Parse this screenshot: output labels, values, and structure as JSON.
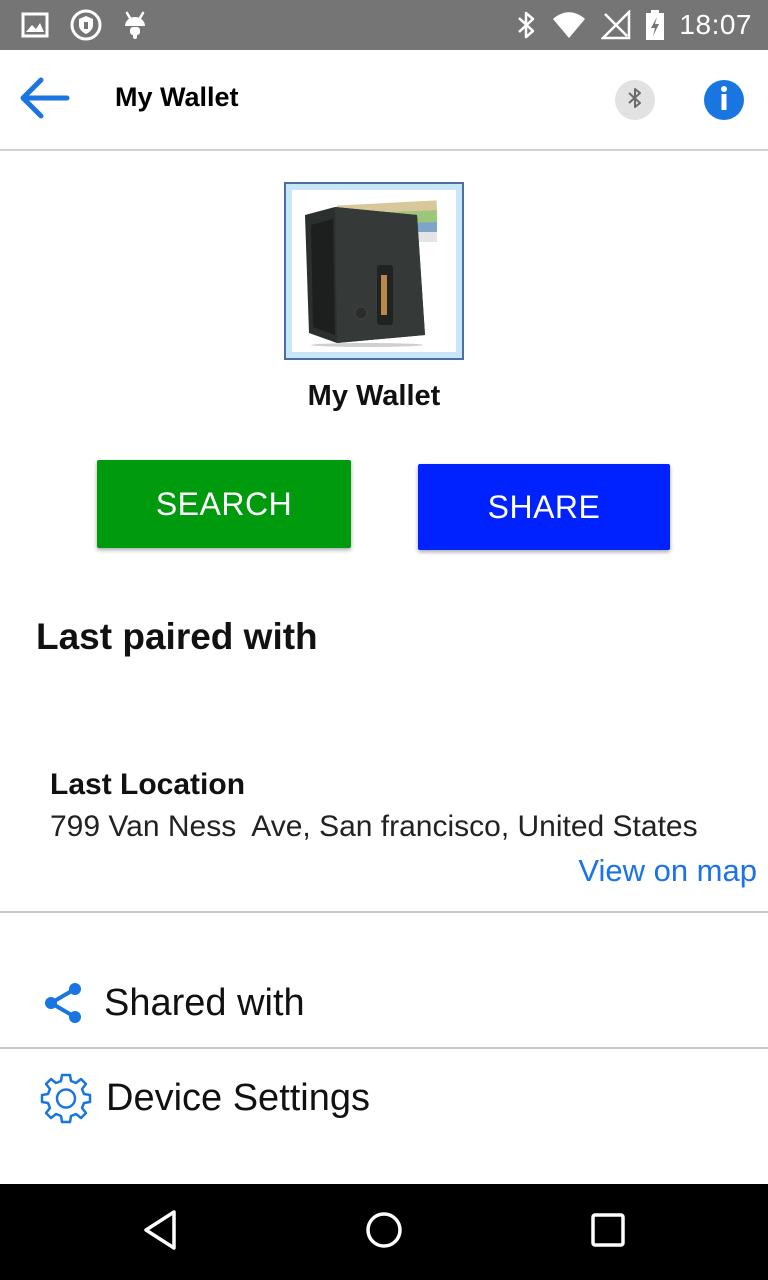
{
  "status_bar": {
    "time": "18:07",
    "left_icons": [
      "image-icon",
      "shield-icon",
      "android-icon"
    ],
    "right_icons": [
      "bluetooth-icon",
      "wifi-icon",
      "signal-icon",
      "battery-icon"
    ]
  },
  "app_bar": {
    "title": "My Wallet",
    "icons": [
      "back-arrow-icon",
      "bluetooth-icon",
      "info-icon"
    ]
  },
  "device": {
    "image": "wallet-image",
    "name": "My Wallet"
  },
  "actions": {
    "search_label": "SEARCH",
    "share_label": "SHARE"
  },
  "pairing": {
    "heading": "Last paired with"
  },
  "location": {
    "label": "Last Location",
    "address": "799 Van Ness  Ave, San francisco, United States",
    "map_link": "View on map"
  },
  "menu": {
    "shared_with": "Shared with",
    "device_settings": "Device Settings"
  },
  "colors": {
    "status_bar": "#757575",
    "search_button": "#009a0e",
    "share_button": "#0022ff",
    "accent_blue": "#1a73e8",
    "nav_bar": "#000000"
  },
  "nav": {
    "icons": [
      "back-triangle-icon",
      "home-circle-icon",
      "recents-square-icon"
    ]
  }
}
